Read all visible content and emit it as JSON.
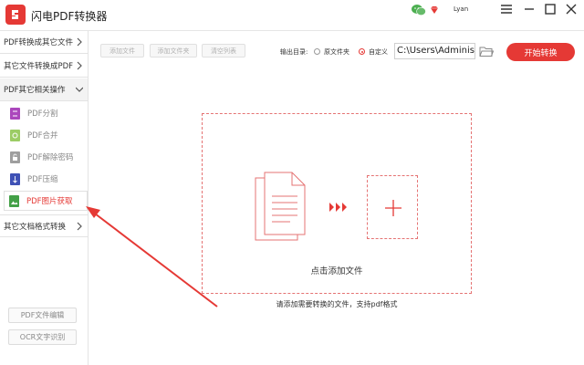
{
  "app": {
    "title": "闪电PDF转换器",
    "user": "Lyan"
  },
  "colors": {
    "accent": "#e53935",
    "dash": "#e57373"
  },
  "sidebar": {
    "categories": [
      {
        "label": "PDF转换成其它文件",
        "chevron": "chevron-right-icon"
      },
      {
        "label": "其它文件转换成PDF",
        "chevron": "chevron-right-icon"
      },
      {
        "label": "PDF其它相关操作",
        "chevron": "chevron-down-icon"
      },
      {
        "label": "其它文档格式转换",
        "chevron": "chevron-right-icon"
      }
    ],
    "subitems": [
      {
        "label": "PDF分割",
        "icon": "split-icon"
      },
      {
        "label": "PDF合并",
        "icon": "merge-icon"
      },
      {
        "label": "PDF解除密码",
        "icon": "unlock-icon"
      },
      {
        "label": "PDF压缩",
        "icon": "compress-icon"
      },
      {
        "label": "PDF图片获取",
        "icon": "image-extract-icon"
      }
    ],
    "bottom_buttons": [
      "PDF文件编辑",
      "OCR文字识别"
    ]
  },
  "toolbar": {
    "add_file": "添加文件",
    "add_folder": "添加文件夹",
    "clear_list": "清空列表",
    "output_label": "输出目录:",
    "option_original": "原文件夹",
    "option_custom": "自定义",
    "output_path": "C:\\Users\\Adminis",
    "start": "开始转换"
  },
  "main": {
    "drop_text": "点击添加文件",
    "hint": "请添加需要转换的文件，支持pdf格式"
  }
}
